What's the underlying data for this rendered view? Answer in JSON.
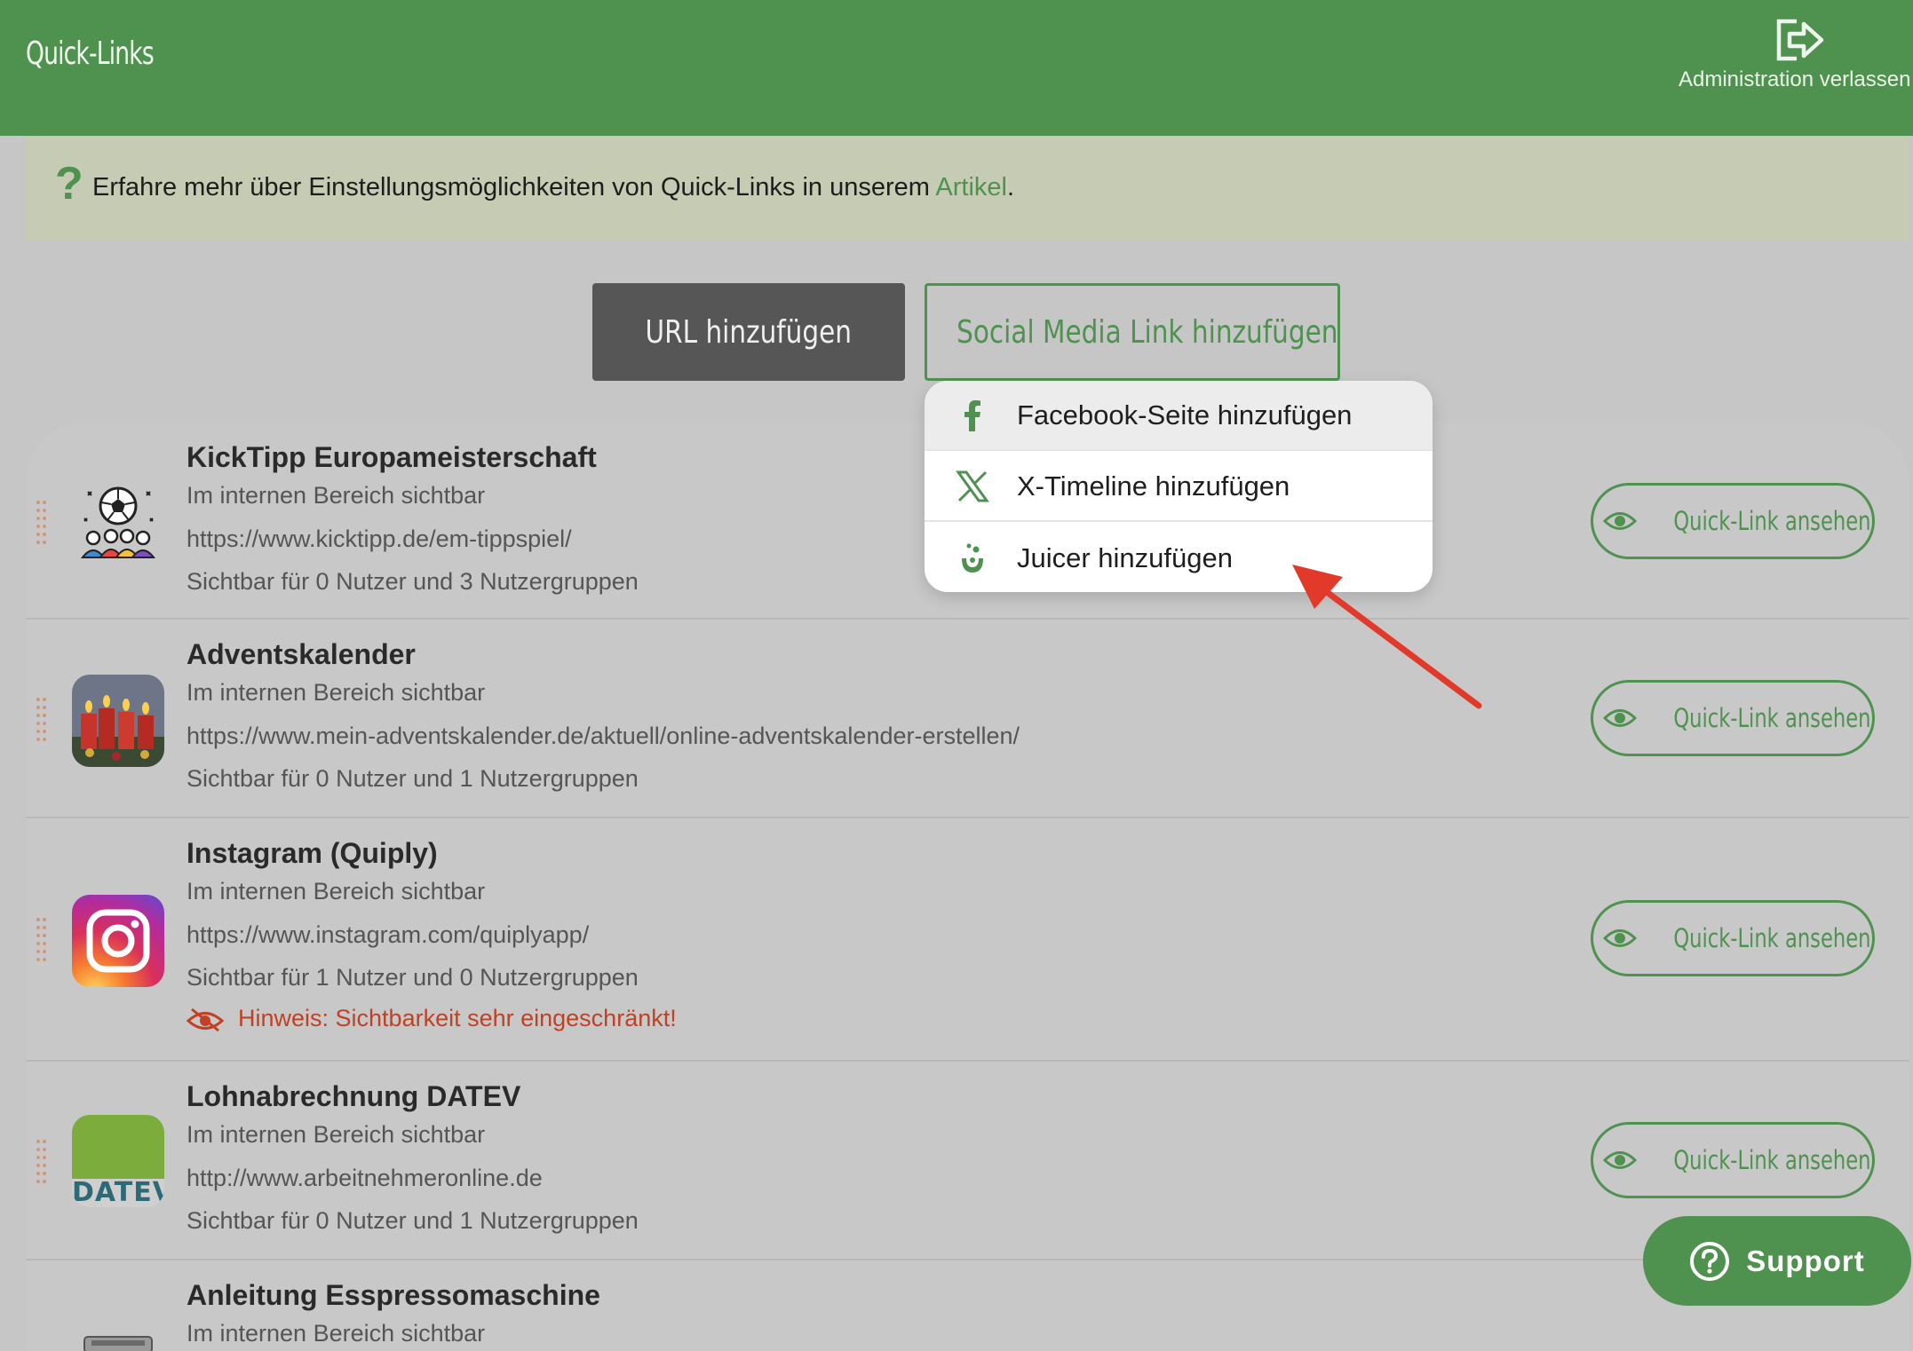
{
  "header": {
    "title": "Quick-Links",
    "exit_label": "Administration verlassen"
  },
  "info": {
    "text_before": "Erfahre mehr über Einstellungsmöglichkeiten von Quick-Links in unserem ",
    "link_text": "Artikel",
    "text_after": "."
  },
  "actions": {
    "add_url": "URL hinzufügen",
    "add_social": "Social Media Link hinzufügen"
  },
  "dropdown": {
    "items": [
      {
        "label": "Facebook-Seite hinzufügen",
        "icon": "facebook-icon"
      },
      {
        "label": "X-Timeline hinzufügen",
        "icon": "x-icon"
      },
      {
        "label": "Juicer hinzufügen",
        "icon": "juicer-icon"
      }
    ]
  },
  "links": [
    {
      "name": "KickTipp Europameisterschaft",
      "area": "Im internen Bereich sichtbar",
      "url": "https://www.kicktipp.de/em-tippspiel/",
      "visibility": "Sichtbar für 0 Nutzer und 3 Nutzergruppen",
      "button": "Quick-Link ansehen",
      "icon": "soccer-fans-icon"
    },
    {
      "name": "Adventskalender",
      "area": "Im internen Bereich sichtbar",
      "url": "https://www.mein-adventskalender.de/aktuell/online-adventskalender-erstellen/",
      "visibility": "Sichtbar für 0 Nutzer und 1 Nutzergruppen",
      "button": "Quick-Link ansehen",
      "icon": "advent-candles-icon"
    },
    {
      "name": "Instagram (Quiply)",
      "area": "Im internen Bereich sichtbar",
      "url": "https://www.instagram.com/quiplyapp/",
      "visibility": "Sichtbar für 1 Nutzer und 0 Nutzergruppen",
      "warning": "Hinweis: Sichtbarkeit sehr eingeschränkt!",
      "button": "Quick-Link ansehen",
      "icon": "instagram-icon"
    },
    {
      "name": "Lohnabrechnung DATEV",
      "area": "Im internen Bereich sichtbar",
      "url": "http://www.arbeitnehmeronline.de",
      "visibility": "Sichtbar für 0 Nutzer und 1 Nutzergruppen",
      "button": "Quick-Link ansehen",
      "icon": "datev-icon",
      "icon_text": "DATEV"
    },
    {
      "name": "Anleitung Esspressomaschine",
      "area": "Im internen Bereich sichtbar",
      "icon": "espresso-machine-icon"
    }
  ],
  "support": {
    "label": "Support"
  },
  "colors": {
    "brand_green": "#4f9250",
    "warning_red": "#c24024",
    "annotation_arrow": "#e23a2a"
  }
}
